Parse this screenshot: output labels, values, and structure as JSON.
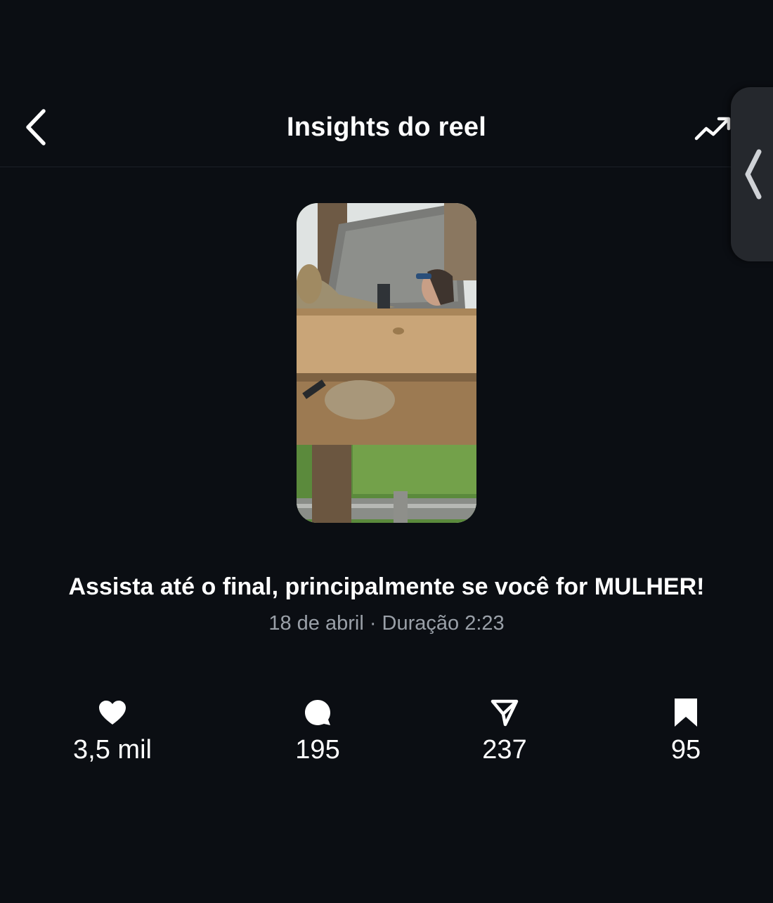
{
  "header": {
    "title": "Insights do reel",
    "back_icon": "chevron-left-icon",
    "trend_icon": "trending-up-icon"
  },
  "side_handle": {
    "icon": "chevron-left-icon"
  },
  "post": {
    "thumbnail": "reel-thumbnail",
    "caption": "Assista até o final, principalmente se você for MULHER!",
    "meta": "18 de abril · Duração 2:23"
  },
  "stats": [
    {
      "icon": "heart-icon",
      "value": "3,5 mil"
    },
    {
      "icon": "comment-icon",
      "value": "195"
    },
    {
      "icon": "share-icon",
      "value": "237"
    },
    {
      "icon": "bookmark-icon",
      "value": "95"
    }
  ],
  "colors": {
    "background": "#0b0e13",
    "text": "#ffffff",
    "secondary_text": "#9aa0a8"
  }
}
